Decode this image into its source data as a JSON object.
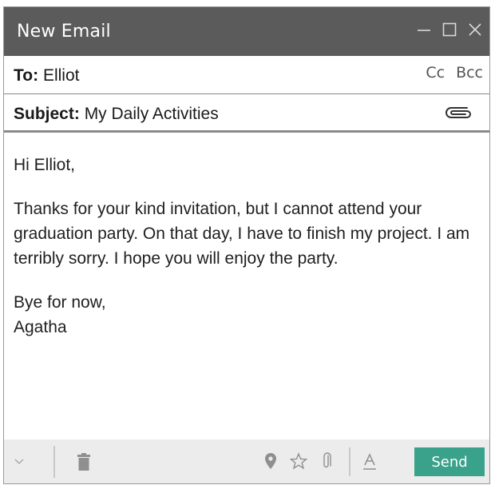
{
  "window": {
    "title": "New Email",
    "controls": [
      "minimize-icon",
      "maximize-icon",
      "close-icon"
    ]
  },
  "to": {
    "label": "To:",
    "value": "Elliot",
    "cc_label": "Cc",
    "bcc_label": "Bcc"
  },
  "subject": {
    "label": "Subject:",
    "value": "My Daily Activities",
    "attach_icon": "paperclip-icon"
  },
  "body": {
    "greeting": "Hi Elliot,",
    "paragraph": "Thanks for your kind invitation, but I cannot attend your graduation party. On that day, I have to finish my project. I am terribly sorry. I hope you will enjoy the party.",
    "closing_line1": "Bye for now,",
    "closing_line2": "Agatha"
  },
  "footer": {
    "icons": [
      "chevron-down-icon",
      "trash-icon",
      "location-pin-icon",
      "star-icon",
      "paperclip-icon",
      "text-format-icon"
    ],
    "send_label": "Send"
  },
  "colors": {
    "titlebar": "#5b5b5b",
    "send_button": "#3aa18a",
    "footer_bg": "#ececec"
  }
}
